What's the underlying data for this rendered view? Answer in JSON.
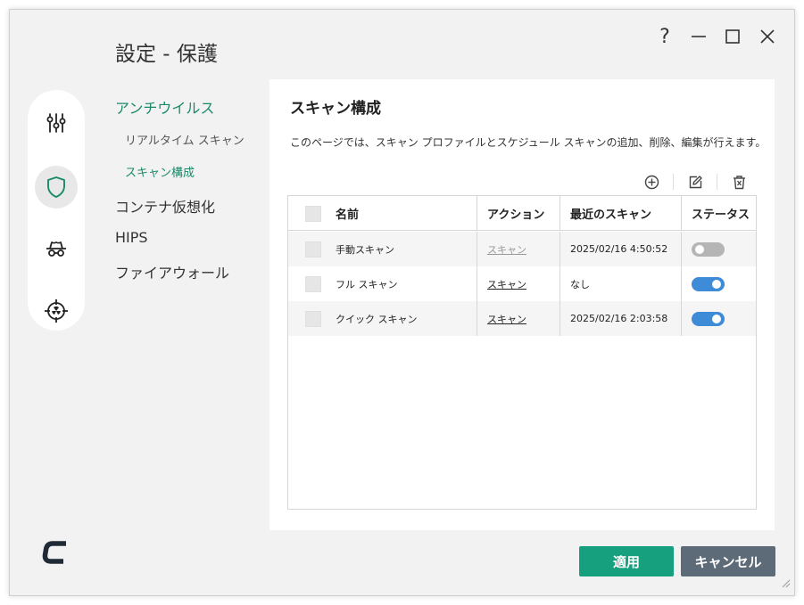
{
  "window": {
    "title": "設定 - 保護",
    "help_label": "?"
  },
  "nav": {
    "items": [
      {
        "label": "アンチウイルス",
        "active": true
      },
      {
        "label": "リアルタイム スキャン",
        "sub": true,
        "active": false
      },
      {
        "label": "スキャン構成",
        "sub": true,
        "active": true
      },
      {
        "label": "コンテナ仮想化",
        "active": false
      },
      {
        "label": "HIPS",
        "active": false
      },
      {
        "label": "ファイアウォール",
        "active": false
      }
    ]
  },
  "rail": {
    "icons": [
      "sliders-icon",
      "shield-icon",
      "spy-icon",
      "crosshair-icon"
    ],
    "active": "shield-icon"
  },
  "panel": {
    "title": "スキャン構成",
    "description": "このページでは、スキャン プロファイルとスケジュール スキャンの追加、削除、編集が行えます。"
  },
  "toolbar": {
    "icons": [
      "add-icon",
      "edit-icon",
      "delete-icon"
    ]
  },
  "table": {
    "columns": [
      "名前",
      "アクション",
      "最近のスキャン",
      "ステータス"
    ],
    "rows": [
      {
        "name": "手動スキャン",
        "action": "スキャン",
        "action_enabled": false,
        "last_scan": "2025/02/16 4:50:52",
        "status": false
      },
      {
        "name": "フル スキャン",
        "action": "スキャン",
        "action_enabled": true,
        "last_scan": "なし",
        "status": true
      },
      {
        "name": "クイック スキャン",
        "action": "スキャン",
        "action_enabled": true,
        "last_scan": "2025/02/16 2:03:58",
        "status": true
      }
    ]
  },
  "buttons": {
    "apply": "適用",
    "cancel": "キャンセル"
  },
  "colors": {
    "accent": "#1a8a6a",
    "apply_bg": "#17a07e",
    "cancel_bg": "#5d6a77",
    "toggle_on": "#3e8bd8",
    "toggle_off": "#b5b5b5"
  }
}
